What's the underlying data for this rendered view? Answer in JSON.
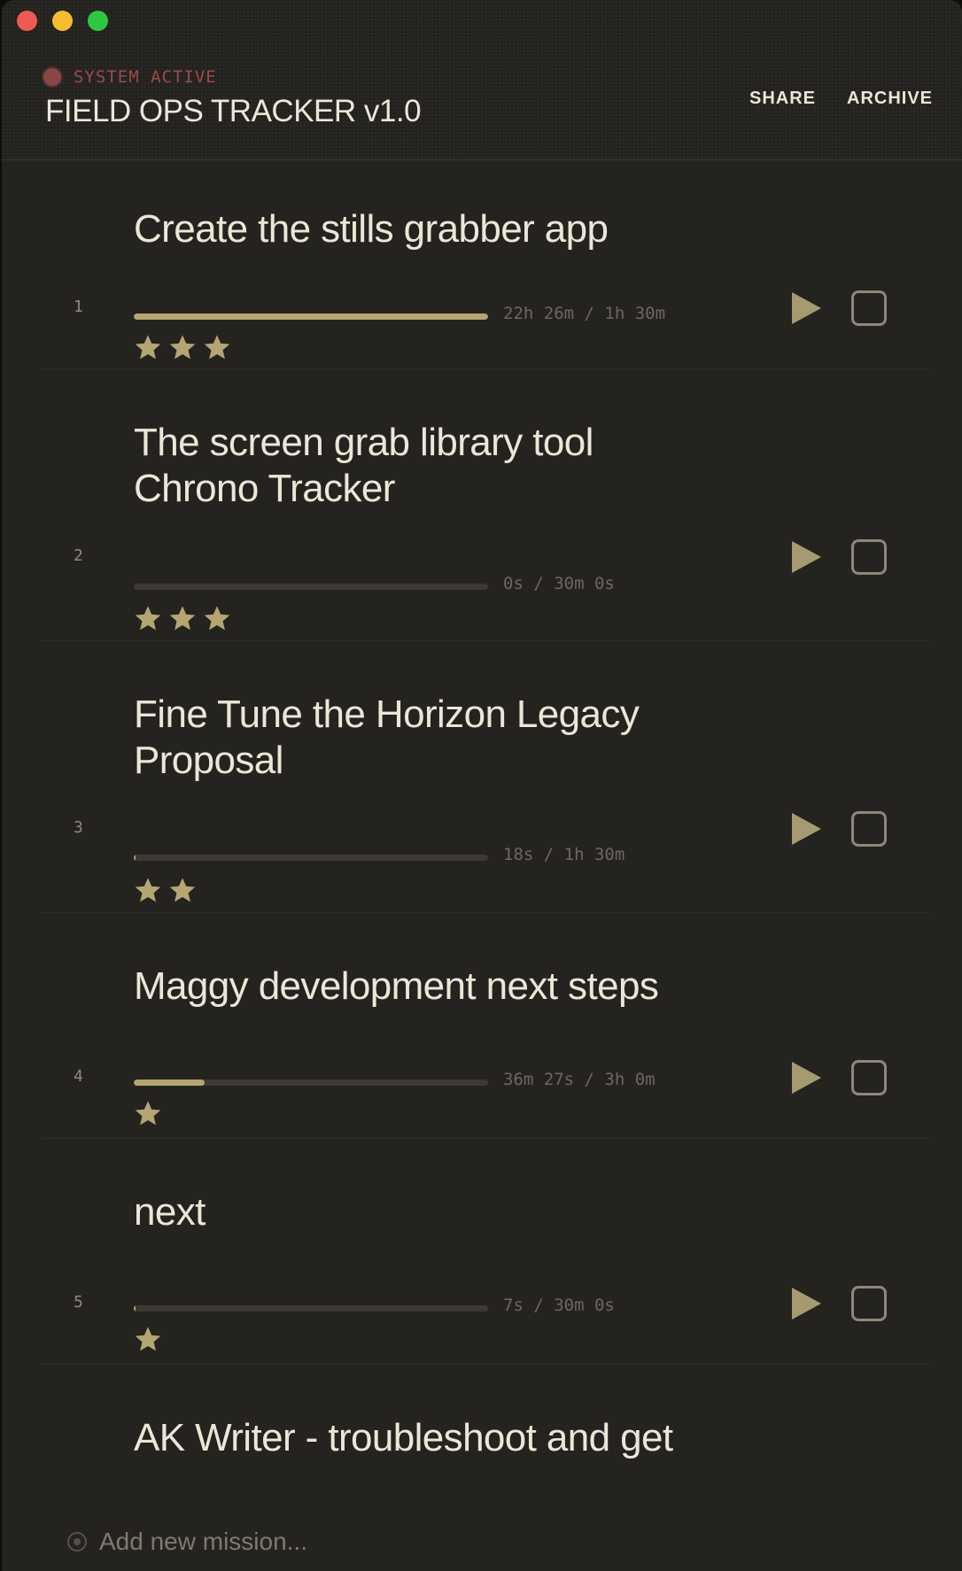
{
  "window": {
    "controls": [
      "close",
      "minimize",
      "zoom"
    ]
  },
  "header": {
    "status": "SYSTEM ACTIVE",
    "title": "FIELD OPS TRACKER v1.0",
    "share_label": "SHARE",
    "archive_label": "ARCHIVE"
  },
  "colors": {
    "accent": "#b5a573",
    "status": "#9c4a48",
    "background": "#252320",
    "text": "#ece6d6"
  },
  "missions": [
    {
      "number": "1",
      "title": "Create the stills grabber app",
      "time": "22h 26m / 1h 30m",
      "progress": 1.0,
      "stars": 3,
      "completed": false
    },
    {
      "number": "2",
      "title": "The screen grab library tool Chrono Tracker",
      "time": "0s / 30m 0s",
      "progress": 0.0,
      "stars": 3,
      "completed": false
    },
    {
      "number": "3",
      "title": "Fine Tune the Horizon Legacy Proposal",
      "time": "18s / 1h 30m",
      "progress": 0.004,
      "stars": 2,
      "completed": false
    },
    {
      "number": "4",
      "title": "Maggy development next steps",
      "time": "36m 27s / 3h 0m",
      "progress": 0.2,
      "stars": 1,
      "completed": false
    },
    {
      "number": "5",
      "title": "next",
      "time": "7s / 30m 0s",
      "progress": 0.004,
      "stars": 1,
      "completed": false
    },
    {
      "number": "",
      "title": "AK Writer - troubleshoot and get",
      "time": "",
      "progress": null,
      "stars": 0,
      "completed": false
    }
  ],
  "add_mission": {
    "placeholder": "Add new mission...",
    "value": ""
  },
  "icons": {
    "play": "play-icon",
    "checkbox": "checkbox-icon",
    "star": "star-icon",
    "add": "target-icon"
  }
}
